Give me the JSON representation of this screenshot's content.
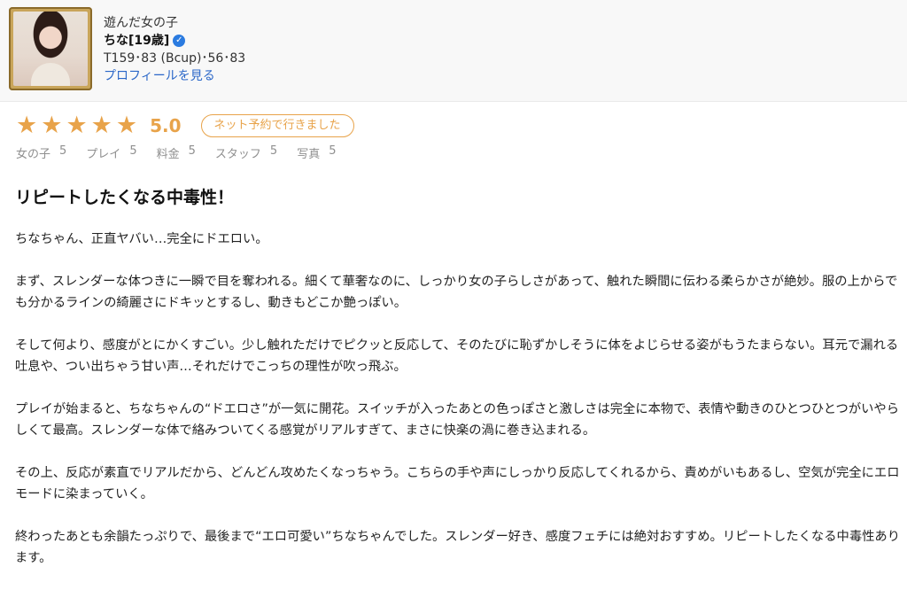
{
  "header": {
    "caption": "遊んだ女の子",
    "name": "ちな[19歳]",
    "verified_icon": "verified-check-icon",
    "stats": "T159･83 (Bcup)･56･83",
    "profile_link": "プロフィールを見る"
  },
  "rating": {
    "stars": 5,
    "score": "5.0",
    "badge": "ネット予約で行きました",
    "subscores": [
      {
        "label": "女の子",
        "value": "5"
      },
      {
        "label": "プレイ",
        "value": "5"
      },
      {
        "label": "料金",
        "value": "5"
      },
      {
        "label": "スタッフ",
        "value": "5"
      },
      {
        "label": "写真",
        "value": "5"
      }
    ],
    "accent_color": "#e8a34a"
  },
  "review": {
    "title": "リピートしたくなる中毒性！",
    "paragraphs": [
      "ちなちゃん、正直ヤバい…完全にドエロい。",
      "まず、スレンダーな体つきに一瞬で目を奪われる。細くて華奢なのに、しっかり女の子らしさがあって、触れた瞬間に伝わる柔らかさが絶妙。服の上からでも分かるラインの綺麗さにドキッとするし、動きもどこか艶っぽい。",
      "そして何より、感度がとにかくすごい。少し触れただけでピクッと反応して、そのたびに恥ずかしそうに体をよじらせる姿がもうたまらない。耳元で漏れる吐息や、つい出ちゃう甘い声…それだけでこっちの理性が吹っ飛ぶ。",
      "プレイが始まると、ちなちゃんの“ドエロさ”が一気に開花。スイッチが入ったあとの色っぽさと激しさは完全に本物で、表情や動きのひとつひとつがいやらしくて最高。スレンダーな体で絡みついてくる感覚がリアルすぎて、まさに快楽の渦に巻き込まれる。",
      "その上、反応が素直でリアルだから、どんどん攻めたくなっちゃう。こちらの手や声にしっかり反応してくれるから、責めがいもあるし、空気が完全にエロモードに染まっていく。",
      "終わったあとも余韻たっぷりで、最後まで“エロ可愛い”ちなちゃんでした。スレンダー好き、感度フェチには絶対おすすめ。リピートしたくなる中毒性あります。"
    ]
  }
}
